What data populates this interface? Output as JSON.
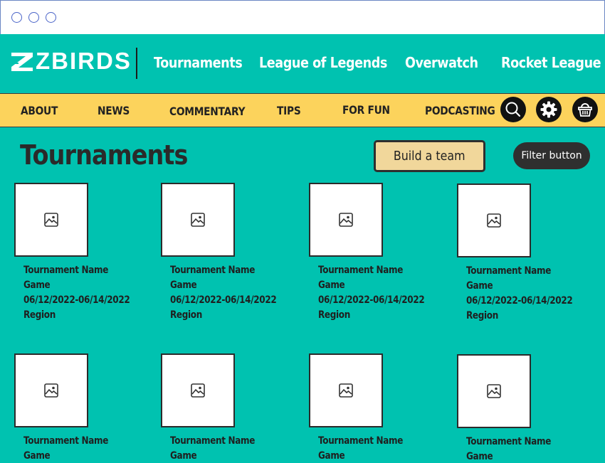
{
  "brand": {
    "logo_text": "ZBIRDS"
  },
  "top_nav": [
    {
      "label": "Tournaments"
    },
    {
      "label": "League of Legends"
    },
    {
      "label": "Overwatch"
    },
    {
      "label": "Rocket League"
    }
  ],
  "sub_nav": [
    {
      "label": "ABOUT"
    },
    {
      "label": "NEWS"
    },
    {
      "label": "COMMENTARY"
    },
    {
      "label": "TIPS"
    },
    {
      "label": "FOR FUN"
    },
    {
      "label": "PODCASTING"
    }
  ],
  "header_icons": [
    "search-icon",
    "gear-icon",
    "basket-icon"
  ],
  "page": {
    "title": "Tournaments",
    "build_team_label": "Build a team",
    "filter_label": "Filter button"
  },
  "cards": [
    {
      "name": "Tournament Name",
      "game": "Game",
      "dates": "06/12/2022-06/14/2022",
      "region": "Region"
    },
    {
      "name": "Tournament Name",
      "game": "Game",
      "dates": "06/12/2022-06/14/2022",
      "region": "Region"
    },
    {
      "name": "Tournament Name",
      "game": "Game",
      "dates": "06/12/2022-06/14/2022",
      "region": "Region"
    },
    {
      "name": "Tournament Name",
      "game": "Game",
      "dates": "06/12/2022-06/14/2022",
      "region": "Region"
    },
    {
      "name": "Tournament Name",
      "game": "Game",
      "dates": "",
      "region": ""
    },
    {
      "name": "Tournament Name",
      "game": "Game",
      "dates": "",
      "region": ""
    },
    {
      "name": "Tournament Name",
      "game": "Game",
      "dates": "",
      "region": ""
    },
    {
      "name": "Tournament Name",
      "game": "Game",
      "dates": "",
      "region": ""
    }
  ],
  "colors": {
    "background": "#00c2b0",
    "subnav": "#fcd35c",
    "build_button": "#f1d79b",
    "filter_button": "#2f2f2f"
  }
}
